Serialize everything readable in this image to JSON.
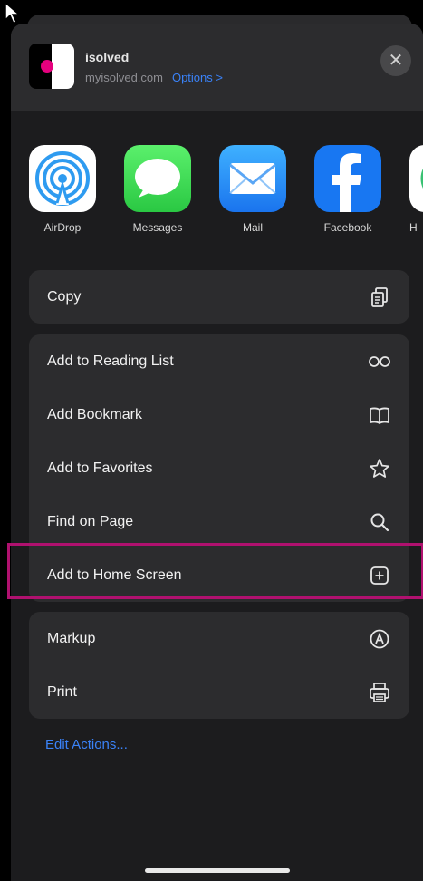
{
  "header": {
    "app_name": "isolved",
    "domain": "myisolved.com",
    "options_label": "Options >",
    "close_label": "✕"
  },
  "share_targets": [
    {
      "label": "AirDrop",
      "icon": "airdrop-icon"
    },
    {
      "label": "Messages",
      "icon": "messages-icon"
    },
    {
      "label": "Mail",
      "icon": "mail-icon"
    },
    {
      "label": "Facebook",
      "icon": "facebook-icon"
    },
    {
      "label": "H",
      "icon": "partial-app-icon"
    }
  ],
  "actions": {
    "copy": {
      "label": "Copy",
      "icon": "copy-icon"
    },
    "group2": [
      {
        "label": "Add to Reading List",
        "icon": "glasses-icon"
      },
      {
        "label": "Add Bookmark",
        "icon": "book-icon"
      },
      {
        "label": "Add to Favorites",
        "icon": "star-icon"
      },
      {
        "label": "Find on Page",
        "icon": "search-icon"
      },
      {
        "label": "Add to Home Screen",
        "icon": "add-square-icon"
      }
    ],
    "group3": [
      {
        "label": "Markup",
        "icon": "markup-icon"
      },
      {
        "label": "Print",
        "icon": "printer-icon"
      }
    ]
  },
  "edit_actions_label": "Edit Actions...",
  "colors": {
    "sheet_background": "#1c1c1e",
    "group_background": "#2c2c2e",
    "link_blue": "#3a82f7",
    "highlight_border": "#b0116f"
  }
}
